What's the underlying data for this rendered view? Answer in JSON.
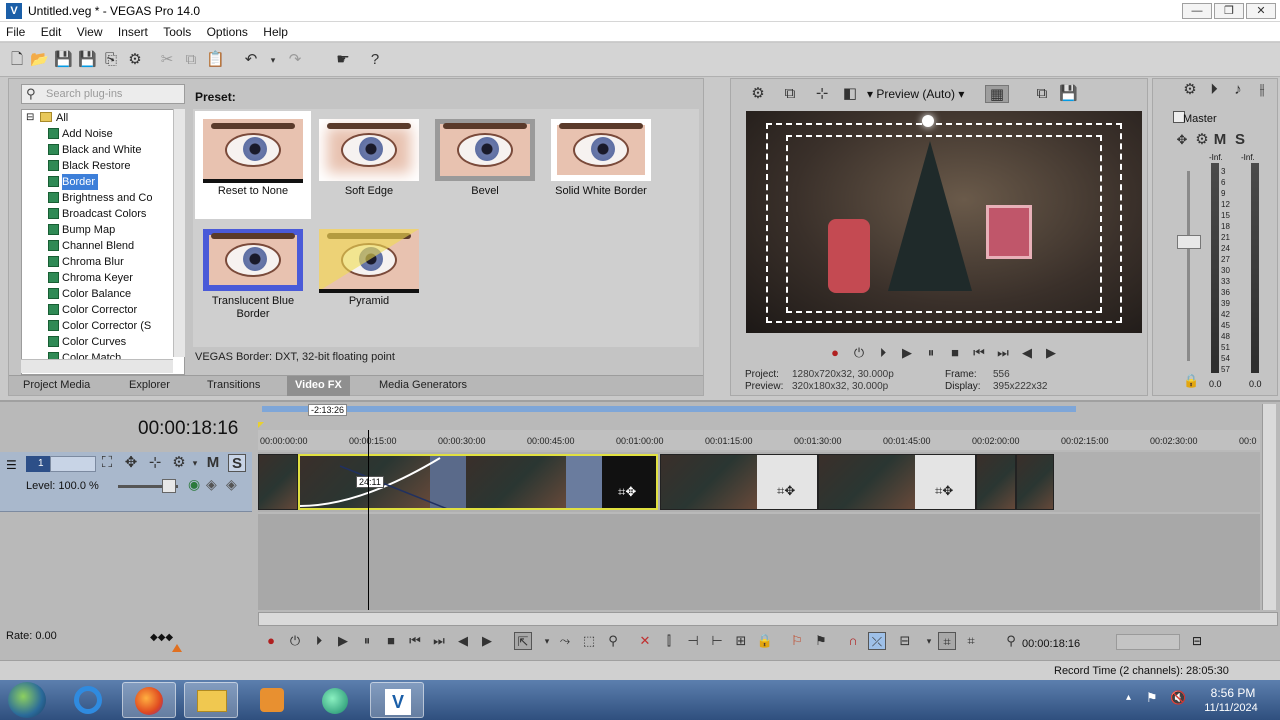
{
  "window": {
    "title": "Untitled.veg * - VEGAS Pro 14.0",
    "logo_letter": "V",
    "minimize": "—",
    "maximize": "❐",
    "close": "✕"
  },
  "menu": [
    "File",
    "Edit",
    "View",
    "Insert",
    "Tools",
    "Options",
    "Help"
  ],
  "plugins": {
    "search_placeholder": "Search plug-ins",
    "root": "All",
    "items": [
      {
        "label": "Add Noise",
        "selected": false
      },
      {
        "label": "Black and White",
        "selected": false
      },
      {
        "label": "Black Restore",
        "selected": false
      },
      {
        "label": "Border",
        "selected": true
      },
      {
        "label": "Brightness and Co",
        "selected": false
      },
      {
        "label": "Broadcast Colors",
        "selected": false
      },
      {
        "label": "Bump Map",
        "selected": false
      },
      {
        "label": "Channel Blend",
        "selected": false
      },
      {
        "label": "Chroma Blur",
        "selected": false
      },
      {
        "label": "Chroma Keyer",
        "selected": false
      },
      {
        "label": "Color Balance",
        "selected": false
      },
      {
        "label": "Color Corrector",
        "selected": false
      },
      {
        "label": "Color Corrector (S",
        "selected": false
      },
      {
        "label": "Color Curves",
        "selected": false
      },
      {
        "label": "Color Match",
        "selected": false
      }
    ],
    "preset_label": "Preset:",
    "presets": [
      {
        "name": "Reset to None",
        "selected": true
      },
      {
        "name": "Soft Edge",
        "selected": false
      },
      {
        "name": "Bevel",
        "selected": false
      },
      {
        "name": "Solid White Border",
        "selected": false
      },
      {
        "name": "Translucent Blue Border",
        "selected": false
      },
      {
        "name": "Pyramid",
        "selected": false
      }
    ],
    "status": "VEGAS Border: DXT, 32-bit floating point",
    "tabs": [
      {
        "label": "Project Media",
        "active": false
      },
      {
        "label": "Explorer",
        "active": false
      },
      {
        "label": "Transitions",
        "active": false
      },
      {
        "label": "Video FX",
        "active": true
      },
      {
        "label": "Media Generators",
        "active": false
      }
    ]
  },
  "preview": {
    "quality": "Preview (Auto)",
    "project_label": "Project:",
    "project_value": "1280x720x32, 30.000p",
    "preview_label": "Preview:",
    "preview_value": "320x180x32, 30.000p",
    "frame_label": "Frame:",
    "frame_value": "556",
    "display_label": "Display:",
    "display_value": "395x222x32"
  },
  "master": {
    "label": "Master",
    "m": "M",
    "s": "S",
    "inf_left": "-Inf.",
    "inf_right": "-Inf.",
    "scale": [
      "3",
      "6",
      "9",
      "12",
      "15",
      "18",
      "21",
      "24",
      "27",
      "30",
      "33",
      "36",
      "39",
      "42",
      "45",
      "48",
      "51",
      "54",
      "57"
    ],
    "bottom_left": "0.0",
    "bottom_right": "0.0"
  },
  "timeline": {
    "time": "00:00:18:16",
    "cursor_label": "-2:13:26",
    "clip_label": "24:11",
    "track_number": "1",
    "m": "M",
    "s": "S",
    "level": "Level: 100.0 %",
    "rate": "Rate: 0.00",
    "ticks": [
      "00:00:00:00",
      "00:00:15:00",
      "00:00:30:00",
      "00:00:45:00",
      "00:01:00:00",
      "00:01:15:00",
      "00:01:30:00",
      "00:01:45:00",
      "00:02:00:00",
      "00:02:15:00",
      "00:02:30:00",
      "00:0"
    ],
    "transport_time": "00:00:18:16"
  },
  "status": {
    "record_time": "Record Time (2 channels): 28:05:30"
  },
  "taskbar": {
    "time": "8:56 PM",
    "date": "11/11/2024"
  },
  "colors": {
    "accent": "#3d7fd9",
    "track_header": "#a9b8cc",
    "selected_clip_border": "#e0e040"
  }
}
